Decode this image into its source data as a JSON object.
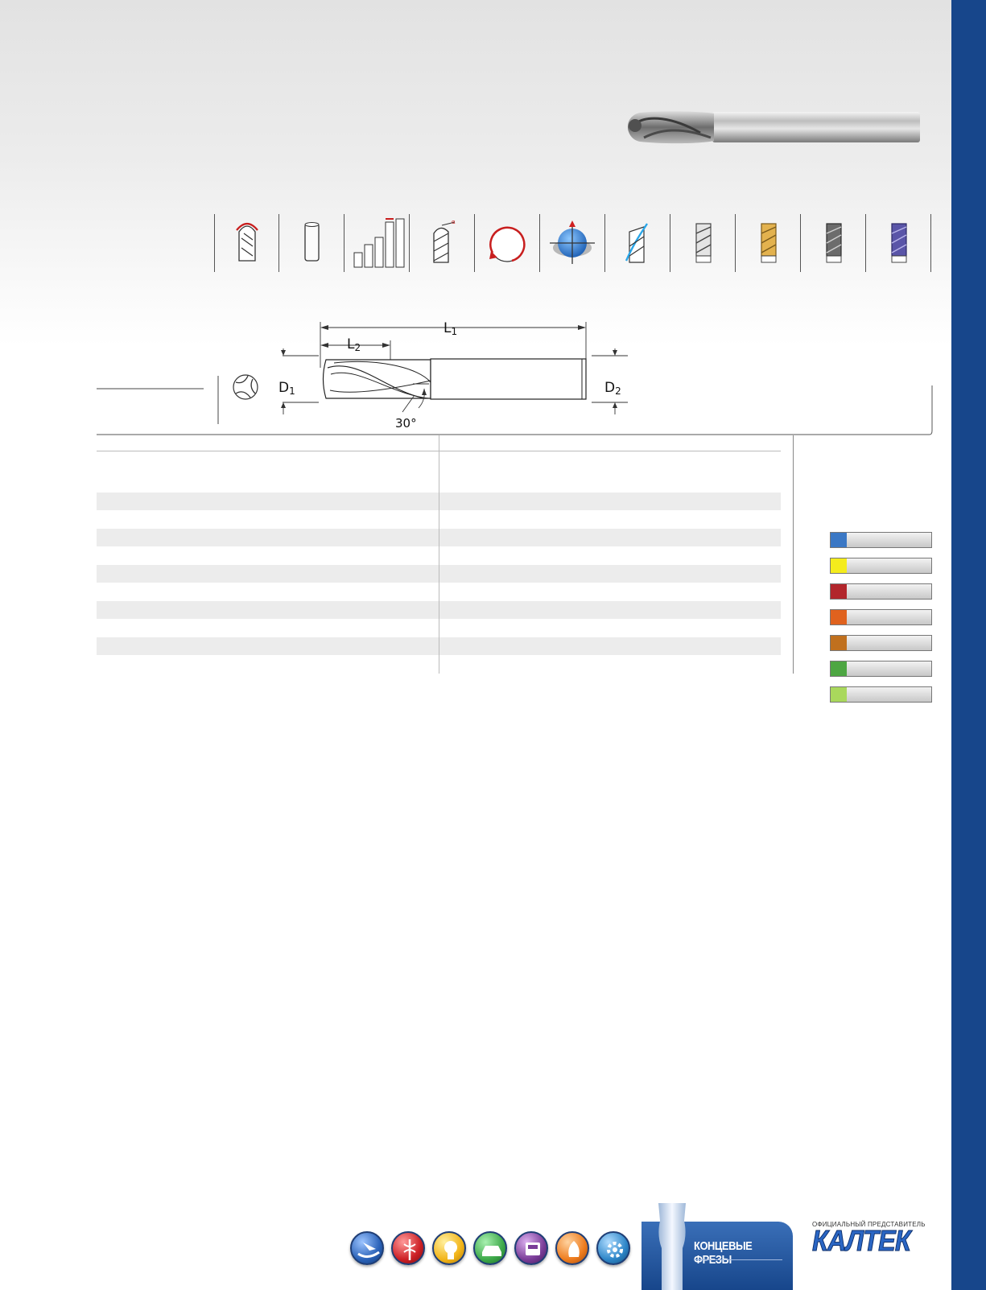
{
  "colors": {
    "brand_blue": "#17468b",
    "stripe": "#ececec"
  },
  "header_icons": [
    {
      "name": "ball-nose-radius-icon"
    },
    {
      "name": "plain-shank-icon"
    },
    {
      "name": "tolerance-bars-icon"
    },
    {
      "name": "helix-angle-icon"
    },
    {
      "name": "rotation-direction-icon"
    },
    {
      "name": "center-cutting-icon"
    },
    {
      "name": "spiral-flute-icon"
    },
    {
      "name": "uncoated-tool-icon"
    },
    {
      "name": "tin-coated-tool-icon"
    },
    {
      "name": "tialn-coated-tool-icon"
    },
    {
      "name": "altin-coated-tool-icon"
    }
  ],
  "diagram": {
    "l1": "L",
    "l1_sub": "1",
    "l2": "L",
    "l2_sub": "2",
    "d1": "D",
    "d1_sub": "1",
    "d2": "D",
    "d2_sub": "2",
    "angle": "30°"
  },
  "table": {
    "stripe_rows": 5
  },
  "legend": [
    {
      "color": "#3b78c5"
    },
    {
      "color": "#f4ec1c"
    },
    {
      "color": "#b2262c"
    },
    {
      "color": "#e0621e"
    },
    {
      "color": "#c0701e"
    },
    {
      "color": "#4da642"
    },
    {
      "color": "#a9d85c"
    }
  ],
  "footer_icons": [
    {
      "name": "aerospace-icon",
      "color": "#2a62b8"
    },
    {
      "name": "medical-icon",
      "color": "#cc1f24"
    },
    {
      "name": "electrical-icon",
      "color": "#f2b418"
    },
    {
      "name": "automotive-icon",
      "color": "#3ea94a"
    },
    {
      "name": "railway-icon",
      "color": "#7a3d98"
    },
    {
      "name": "energy-icon",
      "color": "#ee7c1e"
    },
    {
      "name": "general-engineering-icon",
      "color": "#2e86c8"
    }
  ],
  "footer": {
    "banner_label": "КОНЦЕВЫЕ ФРЕЗЫ",
    "official_rep": "ОФИЦИАЛЬНЫЙ ПРЕДСТАВИТЕЛЬ",
    "logo": "КАЛТЕК"
  }
}
